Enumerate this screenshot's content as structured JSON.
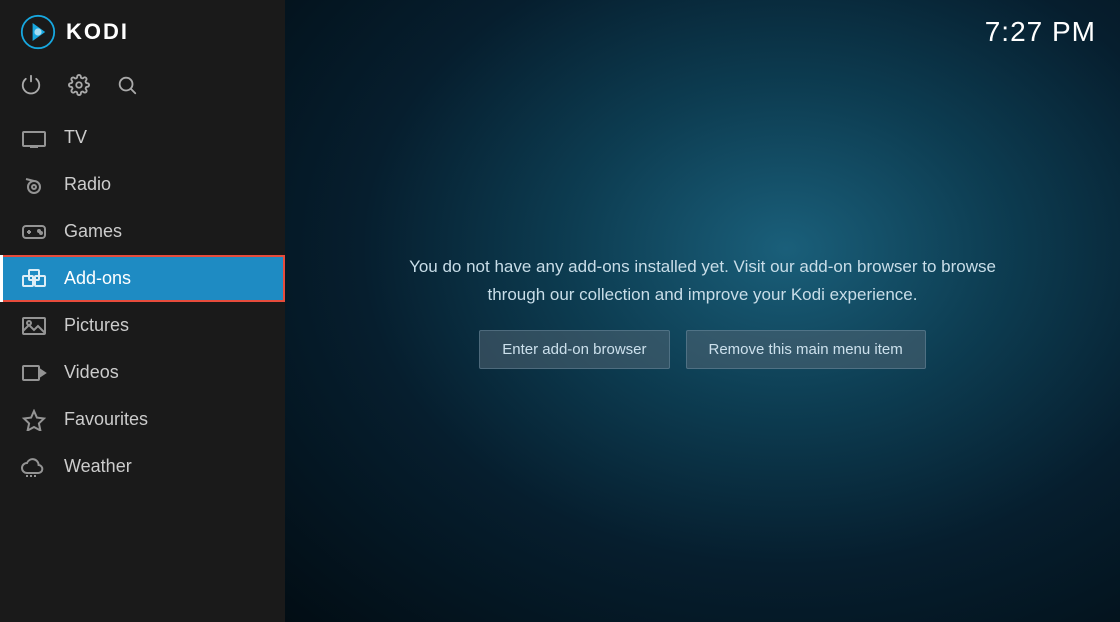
{
  "app": {
    "title": "KODI",
    "time": "7:27 PM"
  },
  "sidebar": {
    "icons": [
      {
        "name": "power-icon",
        "symbol": "⏻"
      },
      {
        "name": "settings-icon",
        "symbol": "⚙"
      },
      {
        "name": "search-icon",
        "symbol": "🔍"
      }
    ],
    "nav_items": [
      {
        "id": "tv",
        "label": "TV",
        "icon": "tv",
        "active": false
      },
      {
        "id": "radio",
        "label": "Radio",
        "icon": "radio",
        "active": false
      },
      {
        "id": "games",
        "label": "Games",
        "icon": "games",
        "active": false
      },
      {
        "id": "addons",
        "label": "Add-ons",
        "icon": "addons",
        "active": true
      },
      {
        "id": "pictures",
        "label": "Pictures",
        "icon": "pictures",
        "active": false
      },
      {
        "id": "videos",
        "label": "Videos",
        "icon": "videos",
        "active": false
      },
      {
        "id": "favourites",
        "label": "Favourites",
        "icon": "favourites",
        "active": false
      },
      {
        "id": "weather",
        "label": "Weather",
        "icon": "weather",
        "active": false
      }
    ]
  },
  "main": {
    "info_text": "You do not have any add-ons installed yet. Visit our add-on browser to browse through our collection and improve your Kodi experience.",
    "buttons": [
      {
        "id": "enter-addon-browser",
        "label": "Enter add-on browser"
      },
      {
        "id": "remove-menu-item",
        "label": "Remove this main menu item"
      }
    ]
  }
}
